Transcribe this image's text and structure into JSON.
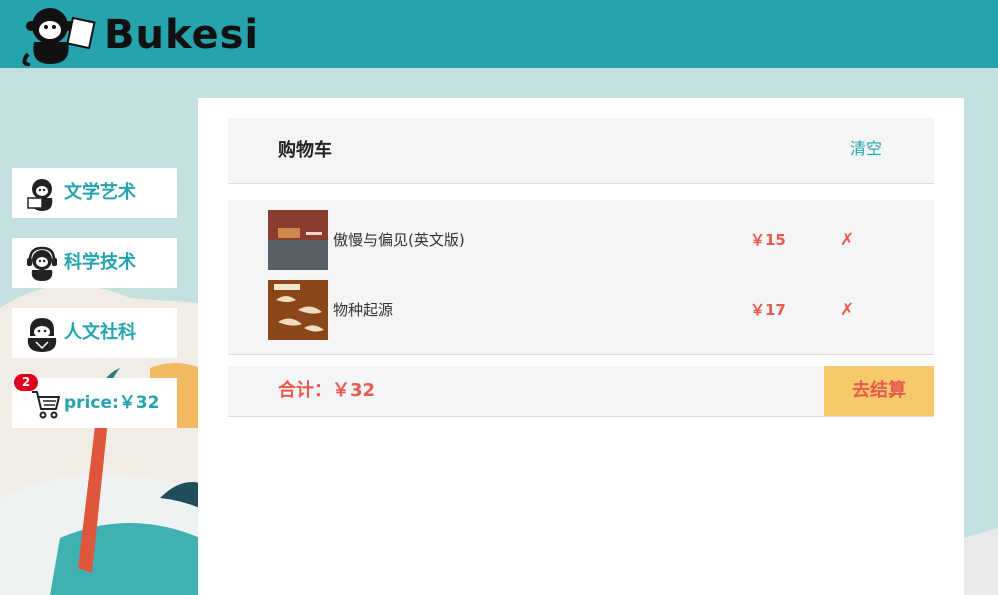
{
  "header": {
    "logo_text": "Bukesi",
    "logo_icon": "monkey-reading-icon",
    "bg_color": "#26a3ad"
  },
  "sidebar": {
    "items": [
      {
        "label": "文学艺术",
        "icon": "monkey-reading-icon"
      },
      {
        "label": "科学技术",
        "icon": "monkey-headphones-icon"
      },
      {
        "label": "人文社科",
        "icon": "gorilla-icon"
      }
    ],
    "cart": {
      "badge": "2",
      "label": "price:￥32",
      "icon": "cart-icon"
    }
  },
  "cart": {
    "title": "购物车",
    "clear_label": "清空",
    "items": [
      {
        "name": "傲慢与偏见(英文版)",
        "price": "￥15",
        "remove": "✗"
      },
      {
        "name": "物种起源",
        "price": "￥17",
        "remove": "✗"
      }
    ],
    "total_label": "合计：￥32",
    "checkout_label": "去结算"
  },
  "colors": {
    "accent": "#26a3ad",
    "price": "#e85a4f",
    "checkout_bg": "#f6c96b",
    "page_bg": "#c4e0df"
  }
}
